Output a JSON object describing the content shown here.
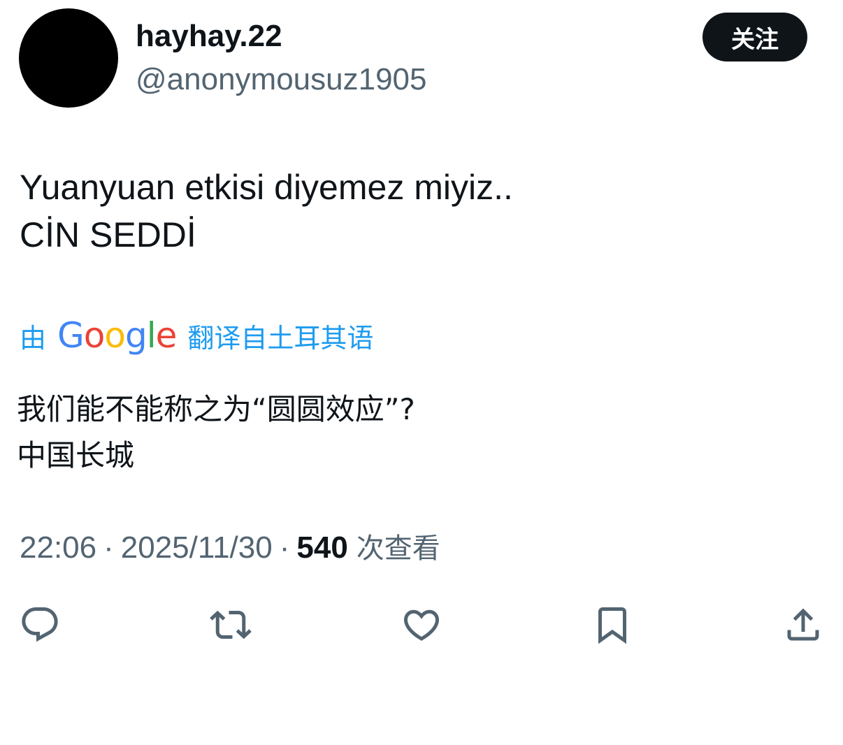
{
  "user": {
    "display_name": "hayhay.22",
    "handle": "@anonymousuz1905",
    "follow_label": "关注"
  },
  "tweet": {
    "lines": [
      "Yuanyuan etkisi diyemez miyiz..",
      "CİN SEDDİ"
    ]
  },
  "translation": {
    "by_label": "由",
    "provider": [
      "G",
      "o",
      "o",
      "g",
      "l",
      "e"
    ],
    "from_label": "翻译自土耳其语",
    "lines": [
      "我们能不能称之为“圆圆效应”?",
      "中国长城"
    ]
  },
  "meta": {
    "time": "22:06",
    "separator": "·",
    "date": "2025/11/30",
    "views_count": "540",
    "views_label": "次查看"
  },
  "actions": {
    "icons": [
      "reply-icon",
      "retweet-icon",
      "like-icon",
      "bookmark-icon",
      "share-icon"
    ]
  },
  "colors": {
    "text_primary": "#0f1419",
    "text_secondary": "#536471",
    "link": "#1d9bf0",
    "google_blue": "#4285f4",
    "google_red": "#ea4335",
    "google_yellow": "#fbbc05",
    "google_green": "#34a853"
  }
}
